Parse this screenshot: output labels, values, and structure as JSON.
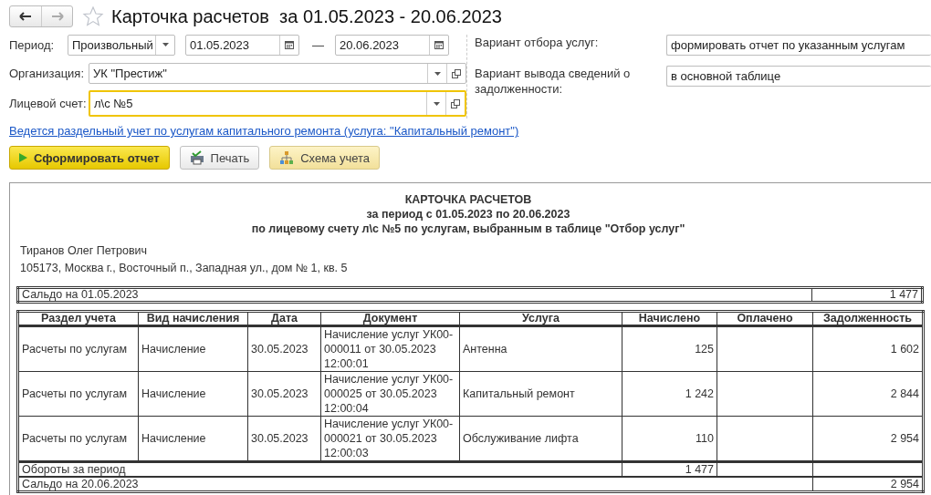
{
  "window": {
    "title": "Карточка расчетов  за 01.05.2023 - 20.06.2023",
    "favorite": false
  },
  "form": {
    "period": {
      "label": "Период:",
      "value": "Произвольный"
    },
    "date_from": "01.05.2023",
    "date_dash": "—",
    "date_to": "20.06.2023",
    "organization": {
      "label": "Организация:",
      "value": "УК \"Престиж\"",
      "focused": false
    },
    "account": {
      "label": "Лицевой счет:",
      "value": "л\\с №5",
      "focused": true
    },
    "service_filter": {
      "label": "Вариант отбора услуг:",
      "value": "формировать отчет по указанным услугам"
    },
    "debt_output": {
      "label": "Вариант вывода сведений о задолженности:",
      "value": "в основной таблице"
    }
  },
  "link": "Ведется раздельный учет по услугам капитального ремонта (услуга: \"Капитальный ремонт\")",
  "buttons": [
    {
      "label": "Сформировать отчет",
      "kind": "primary"
    },
    {
      "label": "Печать",
      "kind": "print"
    },
    {
      "label": "Схема учета",
      "kind": "scheme"
    }
  ],
  "report": {
    "title": "КАРТОЧКА РАСЧЕТОВ",
    "subtitle": "за период с 01.05.2023 по 20.06.2023",
    "subtitle2": "по лицевому счету л\\с №5 по услугам, выбранным в таблице \"Отбор услуг\"",
    "person": "Тиранов Олег Петрович",
    "address": "105173, Москва г., Восточный п., Западная ул., дом № 1, кв. 5",
    "opening": {
      "label": "Сальдо на 01.05.2023",
      "value": "1 477"
    },
    "columns": [
      "Раздел учета",
      "Вид начисления",
      "Дата",
      "Документ",
      "Услуга",
      "Начислено",
      "Оплачено",
      "Задолженность"
    ],
    "rows": [
      [
        "Расчеты по услугам",
        "Начисление",
        "30.05.2023",
        "Начисление услуг УК00-000011 от 30.05.2023 12:00:01",
        "Антенна",
        "125",
        "",
        "1 602"
      ],
      [
        "Расчеты по услугам",
        "Начисление",
        "30.05.2023",
        "Начисление услуг УК00-000025 от 30.05.2023 12:00:04",
        "Капитальный ремонт",
        "1 242",
        "",
        "2 844"
      ],
      [
        "Расчеты по услугам",
        "Начисление",
        "30.05.2023",
        "Начисление услуг УК00-000021 от 30.05.2023 12:00:03",
        "Обслуживание лифта",
        "110",
        "",
        "2 954"
      ]
    ],
    "turnover": {
      "label": "Обороты за период",
      "accrued": "1 477"
    },
    "closing": {
      "label": "Сальдо на 20.06.2023",
      "value": "2 954"
    }
  }
}
